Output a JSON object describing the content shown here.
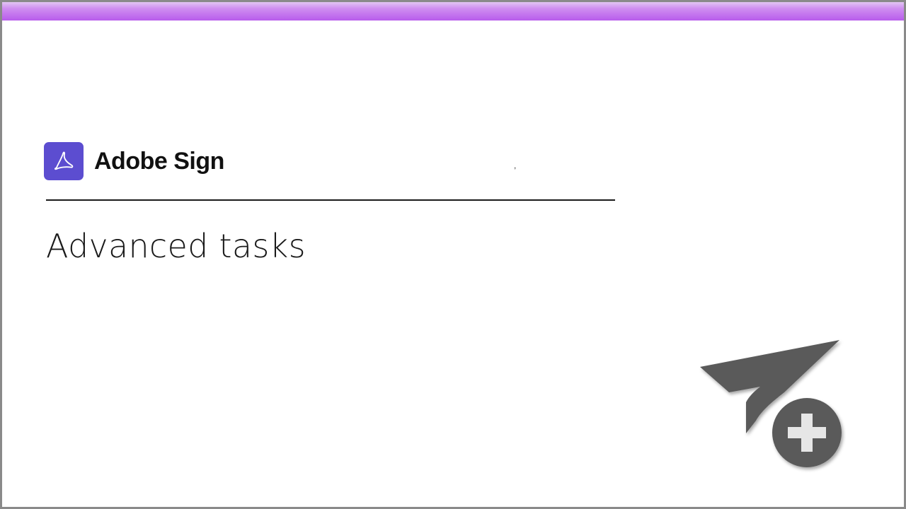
{
  "brand": {
    "name": "Adobe Sign",
    "logo_icon": "acrobat-logo-icon",
    "logo_color": "#5c4dd0"
  },
  "tick_mark": ",",
  "page": {
    "title": "Advanced tasks"
  },
  "illustration": {
    "icon": "send-plus-icon",
    "color": "#5a5a5a"
  },
  "accent_bar_color": "#b85cec"
}
